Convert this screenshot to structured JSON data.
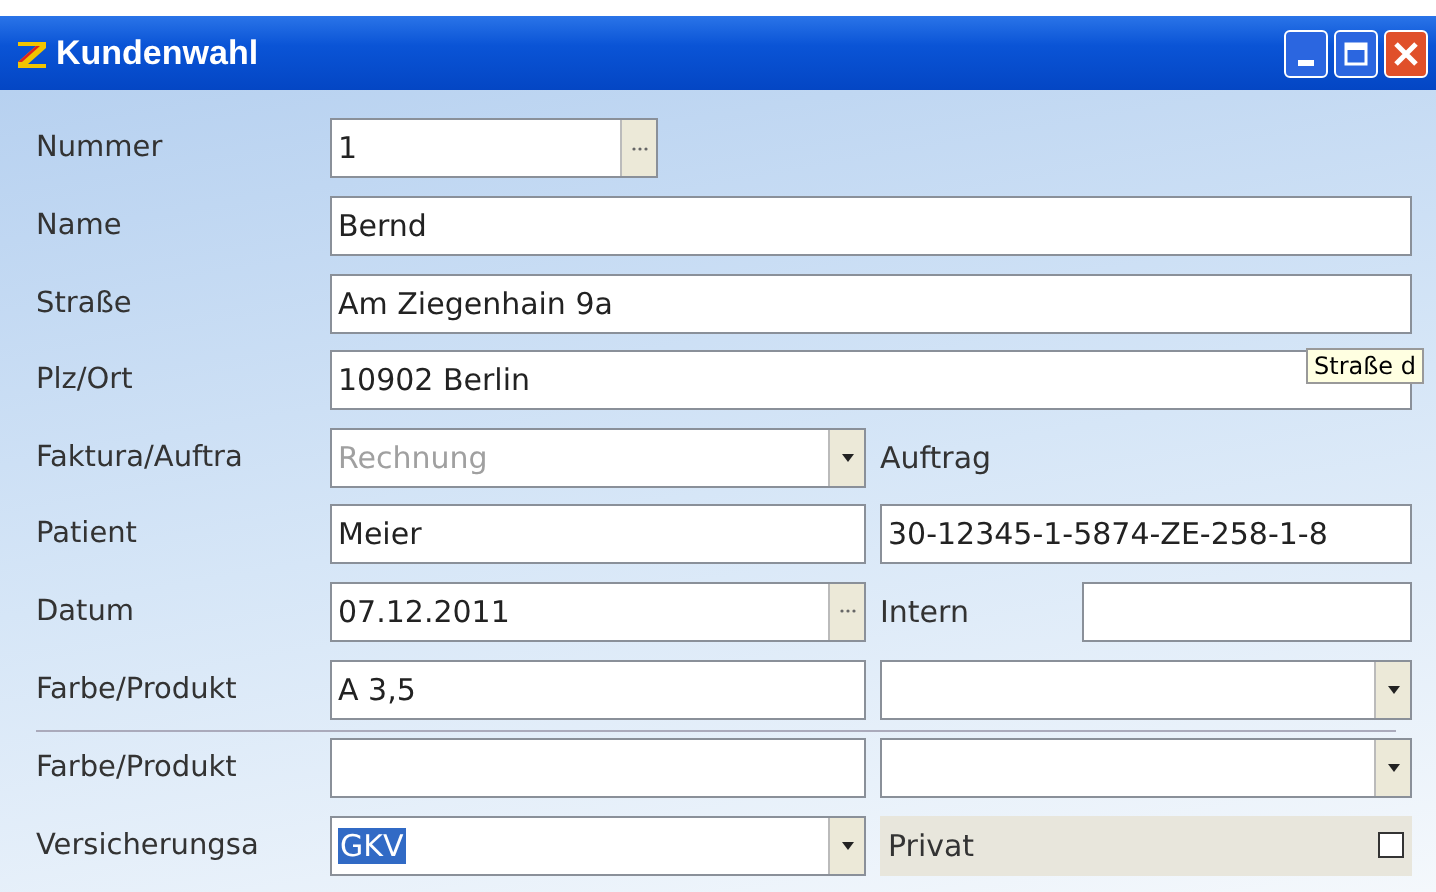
{
  "window": {
    "title": "Kundenwahl"
  },
  "rows": [
    {
      "kind": "field",
      "label": "Nummer",
      "field": {
        "kind": "lookup",
        "value": "1"
      }
    },
    {
      "kind": "field",
      "label": "Name",
      "field": {
        "kind": "text",
        "value": "Bernd"
      }
    },
    {
      "kind": "field",
      "label": "Straße",
      "field": {
        "kind": "text",
        "value": "Am Ziegenhain 9a"
      }
    },
    {
      "kind": "field",
      "label": "Plz/Ort",
      "field": {
        "kind": "text",
        "value": "10902 Berlin"
      }
    },
    {
      "kind": "field",
      "label": "Faktura/Auftra",
      "field": {
        "kind": "combo",
        "value": "Rechnung",
        "disabled": true
      },
      "side": [
        {
          "kind": "label",
          "text": "Auftrag"
        }
      ]
    },
    {
      "kind": "field",
      "label": "Patient",
      "field": {
        "kind": "text",
        "value": "Meier"
      },
      "side": [
        {
          "kind": "text",
          "value": "30-12345-1-5874-ZE-258-1-8"
        }
      ]
    },
    {
      "kind": "field",
      "label": "Datum",
      "field": {
        "kind": "lookup",
        "value": "07.12.2011"
      },
      "side": [
        {
          "kind": "label",
          "text": "Intern"
        },
        {
          "kind": "text"
        }
      ]
    },
    {
      "kind": "field",
      "label": "Farbe/Produkt",
      "field": {
        "kind": "text",
        "value": "A 3,5"
      },
      "side": [
        {
          "kind": "combo"
        }
      ]
    },
    {
      "kind": "divider"
    },
    {
      "kind": "field",
      "label": "Farbe/Produkt",
      "field": {
        "kind": "text"
      },
      "side": [
        {
          "kind": "combo"
        }
      ]
    },
    {
      "kind": "field",
      "label": "Versicherungsa",
      "field": {
        "kind": "combo",
        "value": "GKV",
        "selected": true
      },
      "side": [
        {
          "kind": "checkbox",
          "text": "Privat",
          "checked": false
        }
      ]
    }
  ],
  "tooltip": {
    "text": "Straße d"
  }
}
